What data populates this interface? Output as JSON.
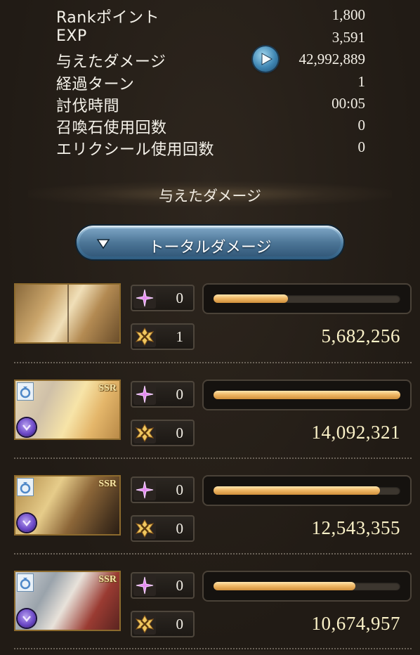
{
  "stats": [
    {
      "label": "Rankポイント",
      "value": "1,800"
    },
    {
      "label": "EXP",
      "value": "3,591"
    },
    {
      "label": "与えたダメージ",
      "value": "42,992,889",
      "icon": "play-icon"
    },
    {
      "label": "経過ターン",
      "value": "1"
    },
    {
      "label": "討伐時間",
      "value": "00:05"
    },
    {
      "label": "召喚石使用回数",
      "value": "0"
    },
    {
      "label": "エリクシール使用回数",
      "value": "0"
    }
  ],
  "damage_section": {
    "title": "与えたダメージ",
    "dropdown": {
      "selected": "トータルダメージ",
      "icon": "caret-down-icon"
    }
  },
  "characters": [
    {
      "special_count": "0",
      "ougi_count": "1",
      "bar_fraction": 0.4,
      "total_damage": "5,682,256",
      "ssr": false,
      "badge": ""
    },
    {
      "special_count": "0",
      "ougi_count": "0",
      "bar_fraction": 1.0,
      "total_damage": "14,092,321",
      "ssr": true,
      "badge": "SSR"
    },
    {
      "special_count": "0",
      "ougi_count": "0",
      "bar_fraction": 0.89,
      "total_damage": "12,543,355",
      "ssr": true,
      "badge": "SSR"
    },
    {
      "special_count": "0",
      "ougi_count": "0",
      "bar_fraction": 0.76,
      "total_damage": "10,674,957",
      "ssr": true,
      "badge": "SSR"
    }
  ],
  "colors": {
    "bar_fill": "#f0b968",
    "accent_blue": "#4d7ea3",
    "background": "#231d17",
    "damage_text": "#fbf2c8"
  }
}
